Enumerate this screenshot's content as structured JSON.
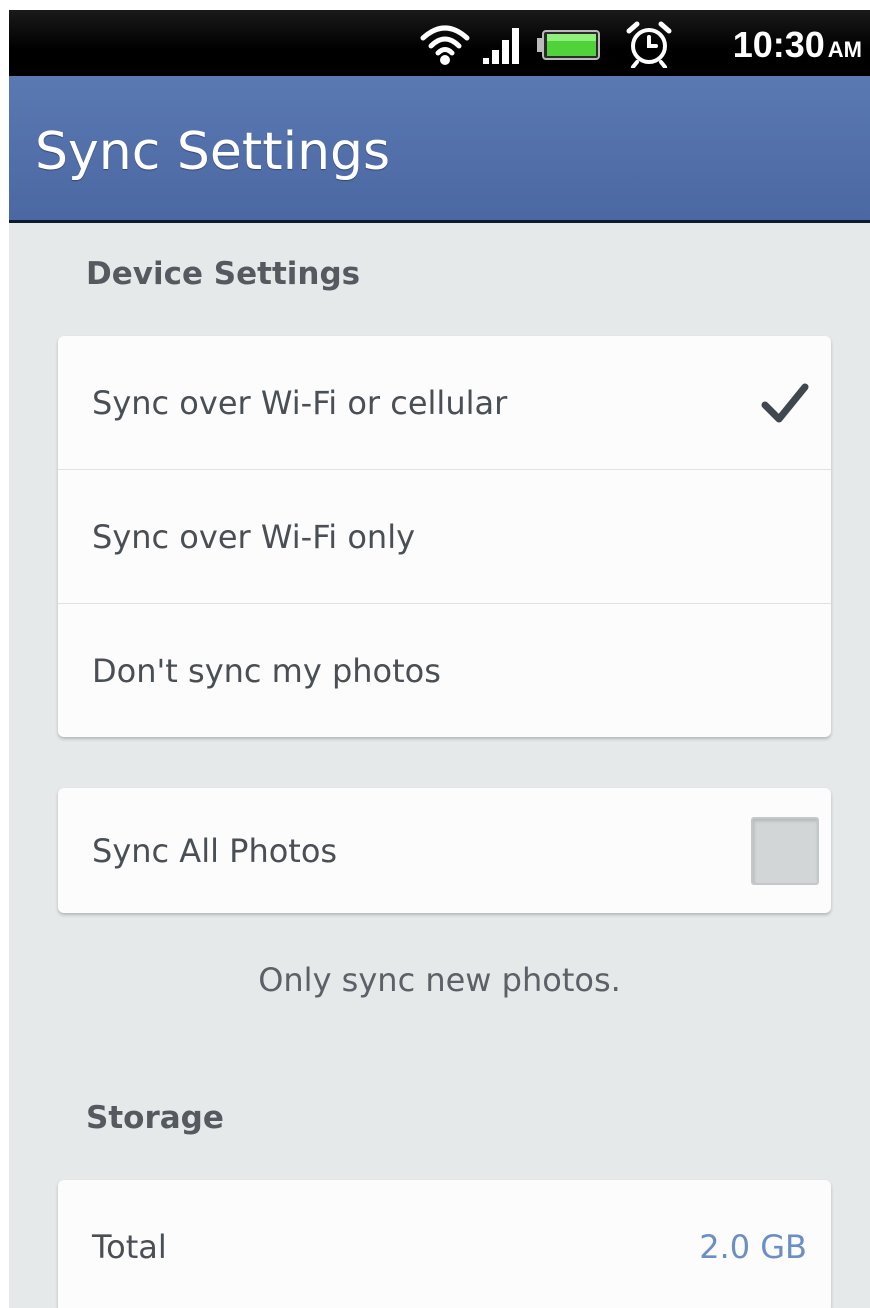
{
  "status_bar": {
    "time": "10:30",
    "ampm": "AM",
    "icons": [
      "wifi-icon",
      "signal-icon",
      "battery-icon",
      "alarm-icon"
    ]
  },
  "header": {
    "title": "Sync Settings",
    "background": "#4f6ca7"
  },
  "device_settings": {
    "label": "Device Settings",
    "options": [
      {
        "label": "Sync over Wi-Fi or cellular",
        "selected": true
      },
      {
        "label": "Sync over Wi-Fi only",
        "selected": false
      },
      {
        "label": "Don't sync my photos",
        "selected": false
      }
    ]
  },
  "sync_all": {
    "label": "Sync All Photos",
    "checked": false,
    "note": "Only sync new photos."
  },
  "storage": {
    "label": "Storage",
    "rows": [
      {
        "label": "Total",
        "value": "2.0 GB"
      }
    ],
    "value_color": "#6b8fc4"
  }
}
